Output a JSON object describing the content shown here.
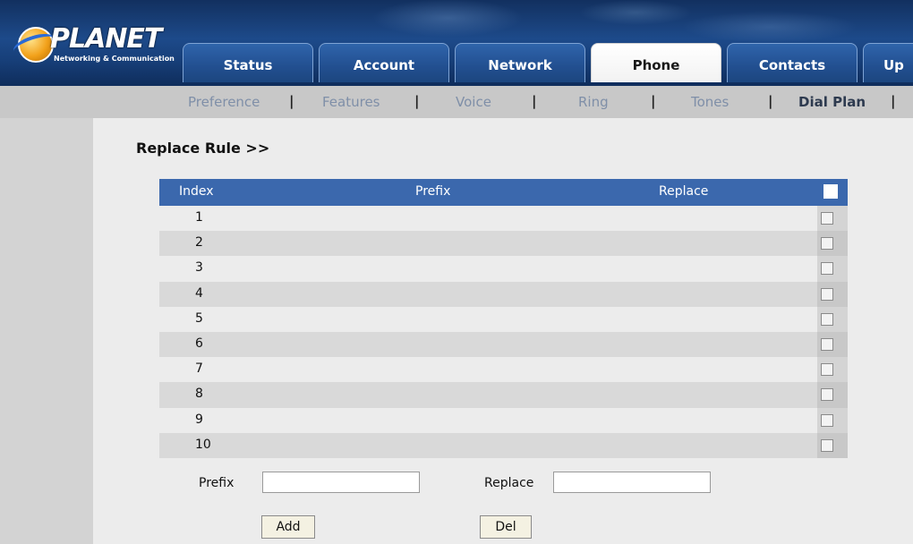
{
  "brand": {
    "name": "PLANET",
    "tagline": "Networking & Communication"
  },
  "tabs": [
    "Status",
    "Account",
    "Network",
    "Phone",
    "Contacts",
    "Up"
  ],
  "active_tab": "Phone",
  "subnav": [
    "Preference",
    "Features",
    "Voice",
    "Ring",
    "Tones",
    "Dial Plan"
  ],
  "active_subnav": "Dial Plan",
  "section_title": "Replace Rule >>",
  "table": {
    "headers": {
      "index": "Index",
      "prefix": "Prefix",
      "replace": "Replace"
    },
    "rows": [
      "1",
      "2",
      "3",
      "4",
      "5",
      "6",
      "7",
      "8",
      "9",
      "10"
    ]
  },
  "form": {
    "prefix_label": "Prefix",
    "replace_label": "Replace",
    "prefix_value": "",
    "replace_value": "",
    "add_label": "Add",
    "del_label": "Del"
  },
  "colors": {
    "header": "#1d4a8a",
    "table_head": "#3b68ad",
    "active_tab": "#ffffff"
  }
}
